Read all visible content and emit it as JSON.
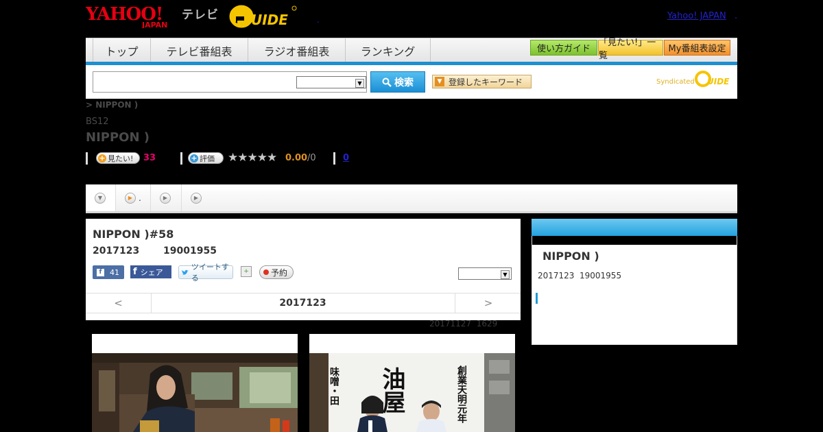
{
  "header": {
    "logo_text": "YAHOO! JAPAN",
    "logo_sub": "テレビ",
    "gguide_logo": "G GUIDE",
    "dot": ".",
    "yj_link": "Yahoo! JAPAN",
    "yj_dot": "."
  },
  "nav": {
    "tabs": [
      "トップ",
      "テレビ番組表",
      "ラジオ番組表",
      "ランキング"
    ],
    "buttons": [
      "使い方ガイド",
      "「見たい!」一覧",
      "My番組表設定"
    ]
  },
  "search": {
    "input_value": "",
    "button_label": "検索",
    "keyword_button": "登録したキーワード",
    "syndicated_label": "Syndicated"
  },
  "program": {
    "breadcrumb": "> NIPPON )",
    "channel": "BS12",
    "title": "NIPPON )",
    "mitai_label": "見たい!",
    "mitai_count": "33",
    "review_label": "評価",
    "stars": "★★★★★",
    "score": "0.00",
    "score_max": "/0",
    "comment_count": "0"
  },
  "tabs": {
    "items": [
      "",
      ".",
      "",
      ""
    ]
  },
  "episode": {
    "title": "NIPPON )#58",
    "date": "2017123",
    "time": "19001955",
    "like_count": "41",
    "share_label": "シェア",
    "tweet_label": "ツイートする",
    "reserve_label": "予約",
    "pager_prev": "<",
    "pager_date": "2017123",
    "pager_next": ">",
    "updated_date": "20171127",
    "updated_time": "1629"
  },
  "side": {
    "title": "NIPPON )",
    "date": "2017123",
    "time": "19001955"
  },
  "photos": {
    "right_banner_left": "味噌・田",
    "right_banner_center": "油屋",
    "right_banner_right": "創業天明元年"
  },
  "colors": {
    "accent_blue": "#1e8fd0",
    "count_pink": "#e8006a",
    "score_orange": "#e09020"
  }
}
